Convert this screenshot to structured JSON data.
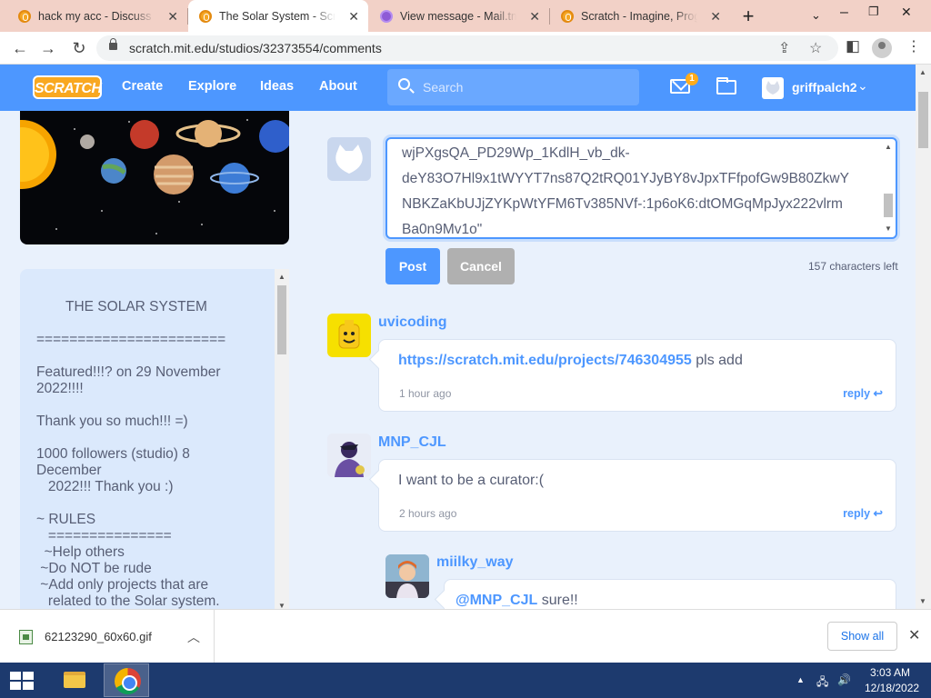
{
  "browser": {
    "tabs": [
      {
        "title": "hack my acc - Discuss Scratch",
        "icon": "scratch-icon",
        "active": false
      },
      {
        "title": "The Solar System - Scratch Studio",
        "icon": "scratch-icon",
        "active": true
      },
      {
        "title": "View message - Mail.tm",
        "icon": "mail-icon",
        "active": false
      },
      {
        "title": "Scratch - Imagine, Program, Share",
        "icon": "scratch-icon",
        "active": false
      }
    ],
    "close_glyph": "✕",
    "new_tab_glyph": "+",
    "url": "scratch.mit.edu/studios/32373554/comments"
  },
  "scratch_nav": {
    "logo": "SCRATCH",
    "links": [
      "Create",
      "Explore",
      "Ideas",
      "About"
    ],
    "search_placeholder": "Search",
    "messages_count": "1",
    "username": "griffpalch2"
  },
  "studio": {
    "description_lines": [
      "THE SOLAR SYSTEM",
      "=======================",
      "Featured!!!? on 29 November",
      "2022!!!!",
      "Thank you so much!!! =)",
      "1000 followers (studio) 8",
      "December",
      "   2022!!! Thank you :)",
      "~ RULES",
      "   ===============",
      "  ~Help others",
      " ~Do NOT be rude",
      " ~Add only projects that are",
      "   related to the Solar system."
    ]
  },
  "compose": {
    "lines": [
      "wjPXgsQA_PD29Wp_1KdlH_vb_dk-",
      "deY83O7Hl9x1tWYYT7ns87Q2tRQ01YJyBY8vJpxTFfpofGw9B80ZkwY",
      "NBKZaKbUJjZYKpWtYFM6Tv385NVf-:1p6oK6:dtOMGqMpJyx222vlrm",
      "Ba0n9Mv1o\""
    ],
    "post_label": "Post",
    "cancel_label": "Cancel",
    "chars_left": "157 characters left"
  },
  "comments": [
    {
      "user": "uvicoding",
      "link": "https://scratch.mit.edu/projects/746304955",
      "text": " pls add",
      "time": "1 hour ago",
      "reply": "reply"
    },
    {
      "user": "MNP_CJL",
      "link": "",
      "text": "I want to be a curator:(",
      "time": "2 hours ago",
      "reply": "reply"
    },
    {
      "user": "miilky_way",
      "link": "@MNP_CJL",
      "text": " sure!!",
      "time": "",
      "reply": ""
    }
  ],
  "downloads": {
    "file_name": "62123290_60x60.gif",
    "show_all": "Show all"
  },
  "taskbar": {
    "time": "3:03 AM",
    "date": "12/18/2022"
  }
}
